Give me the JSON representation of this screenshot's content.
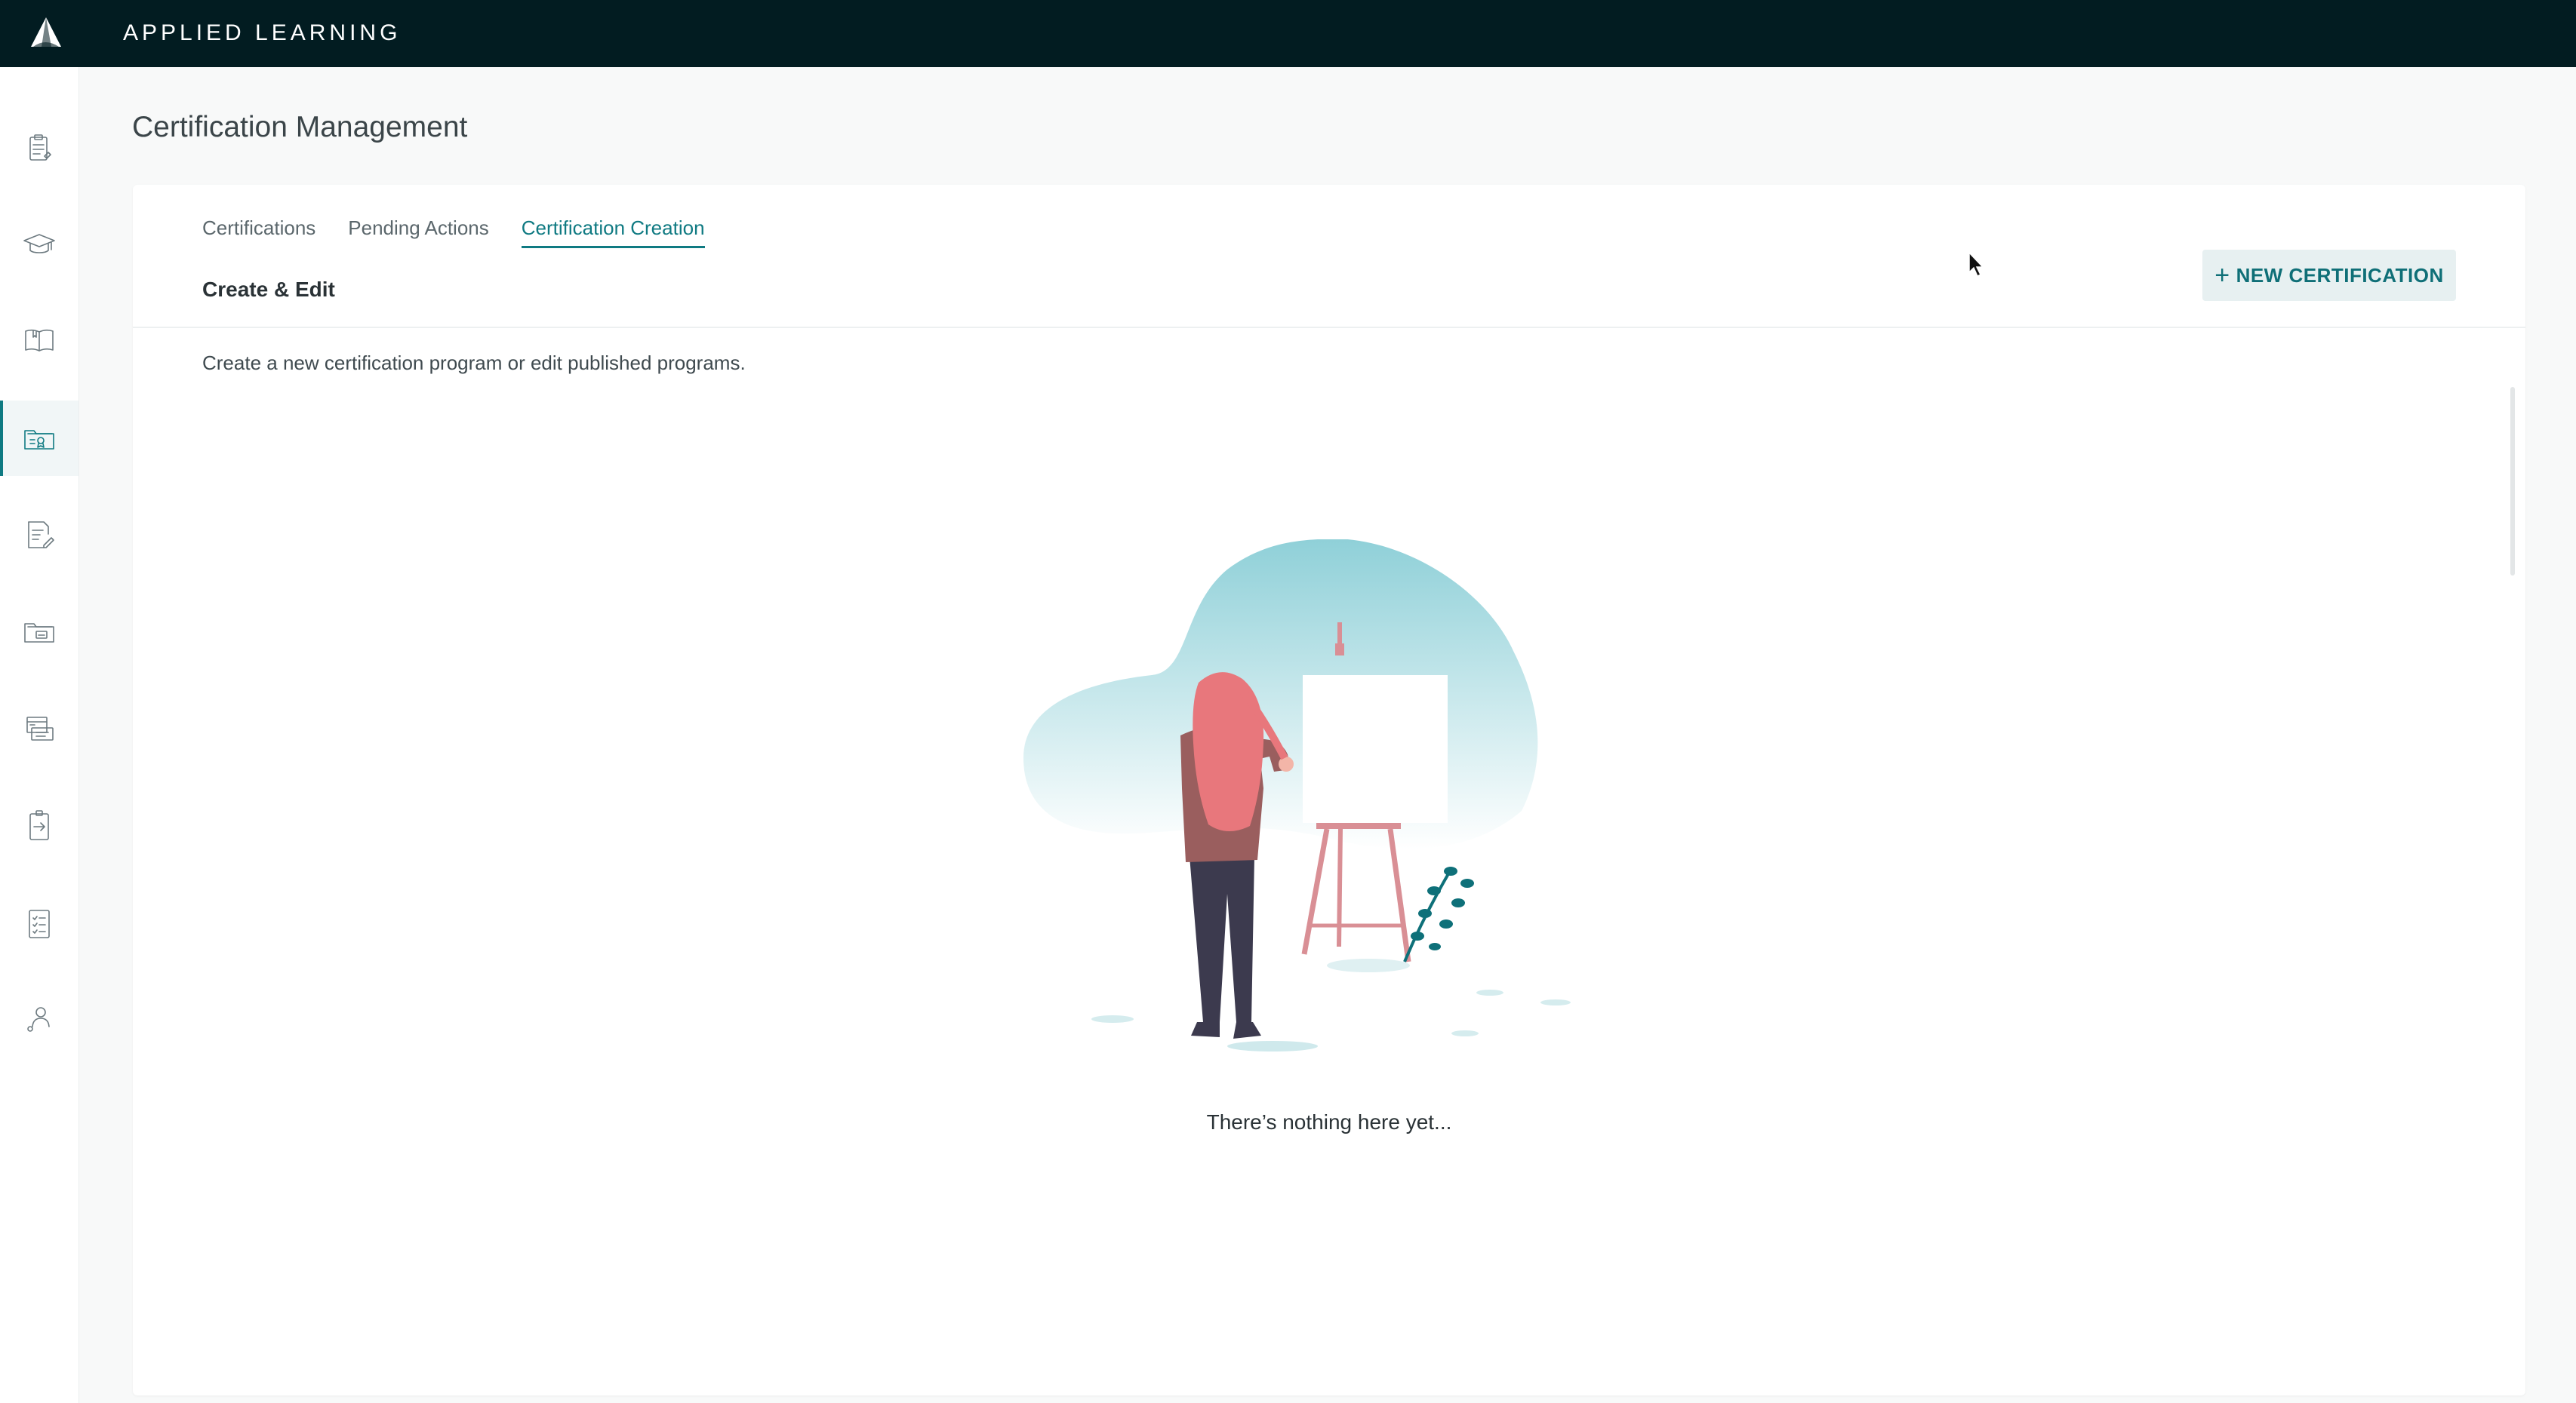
{
  "app": {
    "brand": "APPLIED LEARNING"
  },
  "sidebar": {
    "items": [
      {
        "icon": "clipboard-icon",
        "active": false
      },
      {
        "icon": "graduation-cap-icon",
        "active": false
      },
      {
        "icon": "open-book-icon",
        "active": false
      },
      {
        "icon": "certificate-folder-icon",
        "active": true
      },
      {
        "icon": "edit-document-icon",
        "active": false
      },
      {
        "icon": "folder-icon",
        "active": false
      },
      {
        "icon": "course-library-icon",
        "active": false
      },
      {
        "icon": "assignment-arrow-icon",
        "active": false
      },
      {
        "icon": "checklist-icon",
        "active": false
      },
      {
        "icon": "user-profile-icon",
        "active": false
      }
    ]
  },
  "page": {
    "title": "Certification Management"
  },
  "tabs": [
    {
      "label": "Certifications",
      "active": false
    },
    {
      "label": "Pending Actions",
      "active": false
    },
    {
      "label": "Certification Creation",
      "active": true
    }
  ],
  "section": {
    "title": "Create & Edit",
    "description": "Create a new certification program or edit published programs.",
    "new_button": {
      "plus": "+",
      "label": "NEW CERTIFICATION"
    }
  },
  "empty_state": {
    "message": "There’s nothing here yet..."
  },
  "colors": {
    "topbar": "#021c21",
    "accent": "#0f7a82",
    "button_bg": "#e7f0f1",
    "blob": "#8fd0d8",
    "figure_hair": "#e8777c",
    "easel": "#d98f95",
    "plant": "#0e7079"
  }
}
